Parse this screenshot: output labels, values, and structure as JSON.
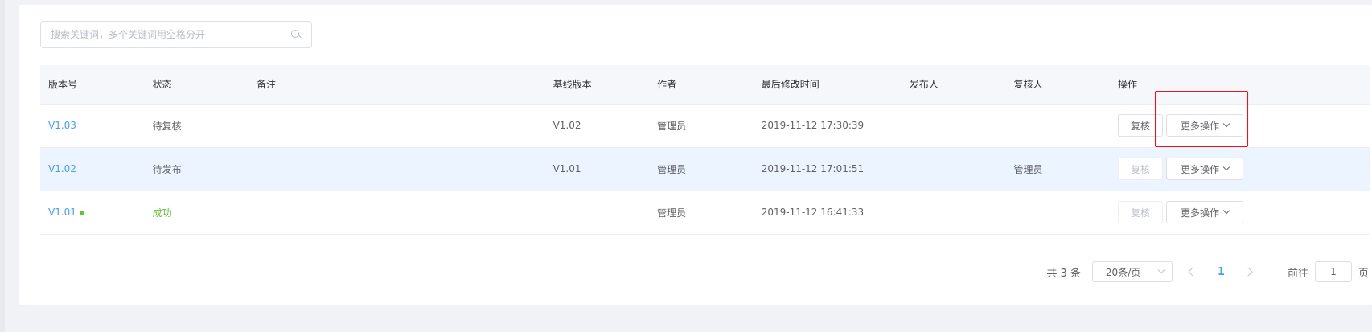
{
  "search": {
    "placeholder": "搜索关键词，多个关键词用空格分开"
  },
  "table": {
    "headers": [
      "版本号",
      "状态",
      "备注",
      "基线版本",
      "作者",
      "最后修改时间",
      "发布人",
      "复核人",
      "操作"
    ],
    "rows": [
      {
        "version": "V1.03",
        "status": "待复核",
        "note": "",
        "base": "V1.02",
        "author": "管理员",
        "modified": "2019-11-12 17:30:39",
        "publisher": "",
        "reviewer": "",
        "review_label": "复核",
        "more_label": "更多操作"
      },
      {
        "version": "V1.02",
        "status": "待发布",
        "note": "",
        "base": "V1.01",
        "author": "管理员",
        "modified": "2019-11-12 17:01:51",
        "publisher": "",
        "reviewer": "管理员",
        "review_label": "复核",
        "more_label": "更多操作"
      },
      {
        "version": "V1.01",
        "status": "成功",
        "note": "",
        "base": "",
        "author": "管理员",
        "modified": "2019-11-12 16:41:33",
        "publisher": "",
        "reviewer": "",
        "review_label": "复核",
        "more_label": "更多操作"
      }
    ]
  },
  "pagination": {
    "total": "共 3 条",
    "page_size": "20条/页",
    "current": "1",
    "goto_label": "前往",
    "goto_value": "1",
    "page_suffix": "页"
  },
  "colors": {
    "accent": "#409eff",
    "success": "#67c23a",
    "highlight": "#e8161a"
  }
}
